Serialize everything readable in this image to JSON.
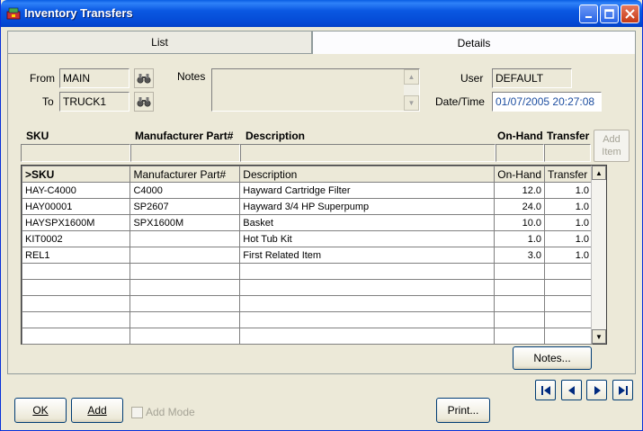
{
  "window": {
    "title": "Inventory Transfers"
  },
  "tabs": {
    "list": "List",
    "details": "Details"
  },
  "form": {
    "from_label": "From",
    "from_value": "MAIN",
    "to_label": "To",
    "to_value": "TRUCK1",
    "notes_label": "Notes",
    "notes_value": "",
    "user_label": "User",
    "user_value": "DEFAULT",
    "datetime_label": "Date/Time",
    "datetime_value": "01/07/2005 20:27:08"
  },
  "filter_headers": {
    "sku": "SKU",
    "mfg": "Manufacturer Part#",
    "desc": "Description",
    "onhand": "On-Hand",
    "transfer": "Transfer"
  },
  "add_item": {
    "line1": "Add",
    "line2": "Item"
  },
  "grid": {
    "columns": [
      ">SKU",
      "Manufacturer Part#",
      "Description",
      "On-Hand",
      "Transfer"
    ],
    "rows": [
      {
        "sku": "HAY-C4000",
        "mfg": "C4000",
        "desc": "Hayward Cartridge Filter",
        "onhand": "12.0",
        "transfer": "1.0"
      },
      {
        "sku": "HAY00001",
        "mfg": "SP2607",
        "desc": "Hayward 3/4 HP Superpump",
        "onhand": "24.0",
        "transfer": "1.0"
      },
      {
        "sku": "HAYSPX1600M",
        "mfg": "SPX1600M",
        "desc": "Basket",
        "onhand": "10.0",
        "transfer": "1.0"
      },
      {
        "sku": "KIT0002",
        "mfg": "",
        "desc": "Hot Tub Kit",
        "onhand": "1.0",
        "transfer": "1.0"
      },
      {
        "sku": "REL1",
        "mfg": "",
        "desc": "First Related Item",
        "onhand": "3.0",
        "transfer": "1.0"
      }
    ]
  },
  "buttons": {
    "notes": "Notes...",
    "ok": "OK",
    "add": "Add",
    "add_mode": "Add Mode",
    "print": "Print..."
  },
  "icons": {
    "app": "app-icon",
    "binoculars": "binoculars-icon",
    "first": "first-record-icon",
    "prev": "previous-record-icon",
    "next": "next-record-icon",
    "last": "last-record-icon"
  },
  "colors": {
    "titlebar": "#0a58e2",
    "accent_text": "#1d4ea0",
    "window_bg": "#ece9d8"
  }
}
